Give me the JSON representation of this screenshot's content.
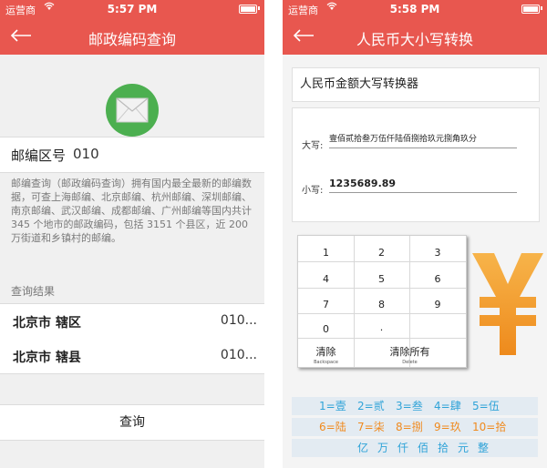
{
  "status": {
    "carrier": "运营商",
    "time_left": "5:57 PM",
    "time_right": "5:58 PM"
  },
  "zip_screen": {
    "title": "邮政编码查询",
    "zip_label": "邮编区号",
    "zip_value": "010",
    "description": "邮编查询（邮政编码查询）拥有国内最全最新的邮编数据，可查上海邮编、北京邮编、杭州邮编、深圳邮编、南京邮编、武汉邮编、成都邮编、广州邮编等国内共计 345 个地市的邮政编码，包括 3151 个县区，近 200 万街道和乡镇村的邮编。",
    "results_header": "查询结果",
    "results": [
      {
        "city": "北京市 辖区",
        "code": "010..."
      },
      {
        "city": "北京市 辖县",
        "code": "010..."
      }
    ],
    "query_button": "查询"
  },
  "rmb_screen": {
    "title": "人民币大小写转换",
    "converter_title": "人民币金额大写转换器",
    "upper_label": "大写:",
    "upper_value": "壹佰贰拾叁万伍仟陆佰捌拾玖元捌角玖分",
    "lower_label": "小写:",
    "lower_value": "1235689.89",
    "keys": [
      "1",
      "2",
      "3",
      "4",
      "5",
      "6",
      "7",
      "8",
      "9",
      "0",
      "."
    ],
    "clear_label": "清除",
    "clear_sub": "Backspace",
    "clear_all_label": "清除所有",
    "clear_all_sub": "Delete",
    "digit_row1": [
      "1=壹",
      "2=贰",
      "3=叁",
      "4=肆",
      "5=伍"
    ],
    "digit_row2": [
      "6=陆",
      "7=柒",
      "8=捌",
      "9=玖",
      "10=拾"
    ],
    "units": [
      "亿",
      "万",
      "仟",
      "佰",
      "拾",
      "元",
      "整"
    ]
  },
  "colors": {
    "nav": "#e8574f",
    "envelope_circle": "#4caf50",
    "yuan_symbol": "#f29b2b",
    "digit_blue": "#2fa3d8",
    "digit_orange": "#f08a1e"
  },
  "icons": [
    "back-arrow-icon",
    "wifi-icon",
    "battery-icon",
    "envelope-icon",
    "yuan-symbol-icon"
  ]
}
